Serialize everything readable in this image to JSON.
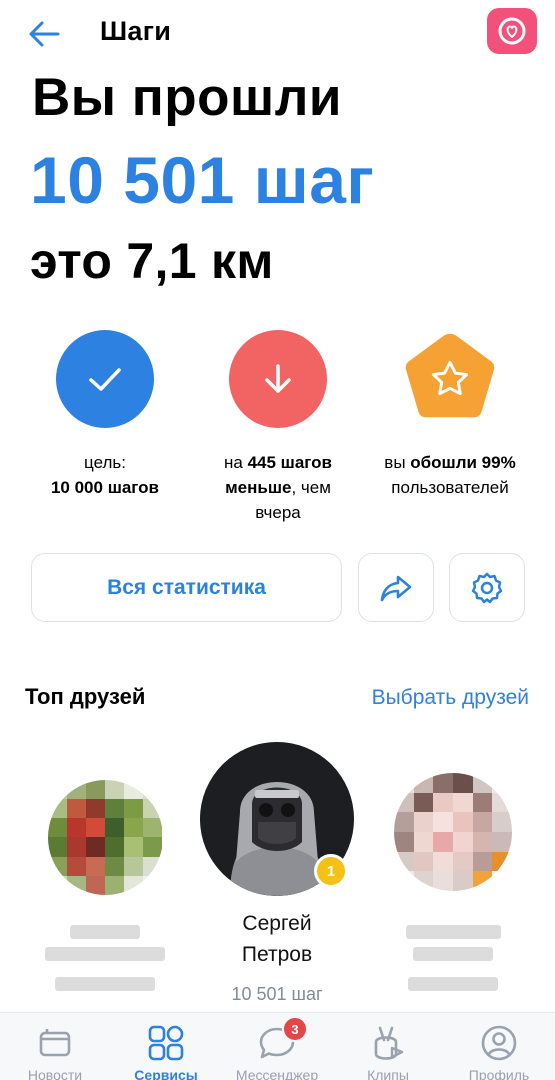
{
  "header": {
    "title": "Шаги"
  },
  "hero": {
    "line1": "Вы прошли",
    "line2": "10 501 шаг",
    "line3": "это 7,1 км"
  },
  "stats": [
    {
      "pre": "цель:",
      "bold": "10 000 шагов",
      "post": ""
    },
    {
      "pre": "на ",
      "bold": "445 шагов меньше",
      "post": ", чем вчера"
    },
    {
      "pre": "вы ",
      "bold": "обошли 99%",
      "post": " пользователей"
    }
  ],
  "actions": {
    "all_stats_label": "Вся статистика"
  },
  "friends_section": {
    "title": "Топ друзей",
    "link": "Выбрать друзей"
  },
  "friends": [
    {
      "name": "",
      "steps": ""
    },
    {
      "name": "Сергей Петров",
      "steps": "10 501 шаг",
      "rank": "1"
    },
    {
      "name": "",
      "steps": ""
    }
  ],
  "tabbar": {
    "items": [
      {
        "label": "Новости",
        "icon": "news-icon"
      },
      {
        "label": "Сервисы",
        "icon": "services-icon",
        "active": true
      },
      {
        "label": "Мессенджер",
        "icon": "messenger-icon"
      },
      {
        "label": "Клипы",
        "icon": "clips-icon"
      },
      {
        "label": "Профиль",
        "icon": "profile-icon"
      }
    ],
    "messenger_badge": "3"
  },
  "colors": {
    "accent": "#2d81e0",
    "red": "#f26363",
    "orange": "#f6a134",
    "pink": "#f2517a"
  }
}
